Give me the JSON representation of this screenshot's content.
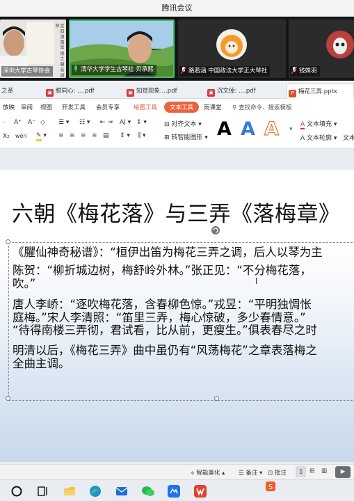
{
  "window": {
    "title": "腾讯会议"
  },
  "video_tiles": [
    {
      "name": "深圳大学古琴协会",
      "side_text": "宮 四 漢 蕭 琴 德 之 聲 音 調 琴"
    },
    {
      "name": "清华大学学生古琴社 贝承熙"
    },
    {
      "name": "路若涵 中国政法大学正大琴社"
    },
    {
      "name": "钱姝羽"
    }
  ],
  "doc_tabs": [
    {
      "label": "之革",
      "icon": ""
    },
    {
      "label": "眼同心: ....pdf",
      "icon": "pdf-icon"
    },
    {
      "label": "知觉现象....pdf",
      "icon": "pdf-icon"
    },
    {
      "label": "沉文倬: ....pdf",
      "icon": "pdf-icon"
    },
    {
      "label": "梅花三弄.pptx",
      "icon": "ppt-icon"
    }
  ],
  "menu": {
    "items": [
      "放映",
      "审阅",
      "视图",
      "开发工具",
      "会员专享"
    ],
    "drawing_tools": "绘图工具",
    "text_tools": "文本工具",
    "cloud": "雨课堂",
    "search": "查找命令、搜索模板"
  },
  "toolbar": {
    "row1": {
      "font_bigger": "A⁺",
      "font_smaller": "A⁻",
      "clear": "◇",
      "align_text": "对齐文本",
      "text_fill": "文本填充",
      "text_outline": "文本轮廓",
      "text_effect": "文本"
    },
    "row2": {
      "subscript": "X₂",
      "phonetic": "wén",
      "convert_smartart": "转智能图形"
    },
    "styles": [
      "A",
      "A",
      "A"
    ]
  },
  "slide": {
    "title": "六朝《梅花落》与三弄《落梅章》",
    "lines": [
      "《臞仙神奇秘谱》：“桓伊出笛为梅花三弄之调，后人以琴为主",
      "陈贺：“柳折城边树，梅舒岭外林。”张正见：“不分梅花落，",
      "吹。”",
      "唐人李峤：“逐吹梅花落，含春柳色惊。”戎昱：“平明独惆怅",
      "庭梅。”宋人李清照：“笛里三弄，梅心惊破，多少春情意。”",
      "“待得南楼三弄彻，君试看，比从前，更瘦生。”俱表春尽之时",
      "明清以后，《梅花三弄》曲中虽仍有“风荡梅花”之章表落梅之",
      "全曲主调。"
    ]
  },
  "status": {
    "beautify": "智能美化",
    "notes": "备注",
    "comments": "批注"
  },
  "colors": {
    "accent": "#e8643f",
    "pdf": "#d7373b",
    "taskbar": "#e9ecf1"
  }
}
